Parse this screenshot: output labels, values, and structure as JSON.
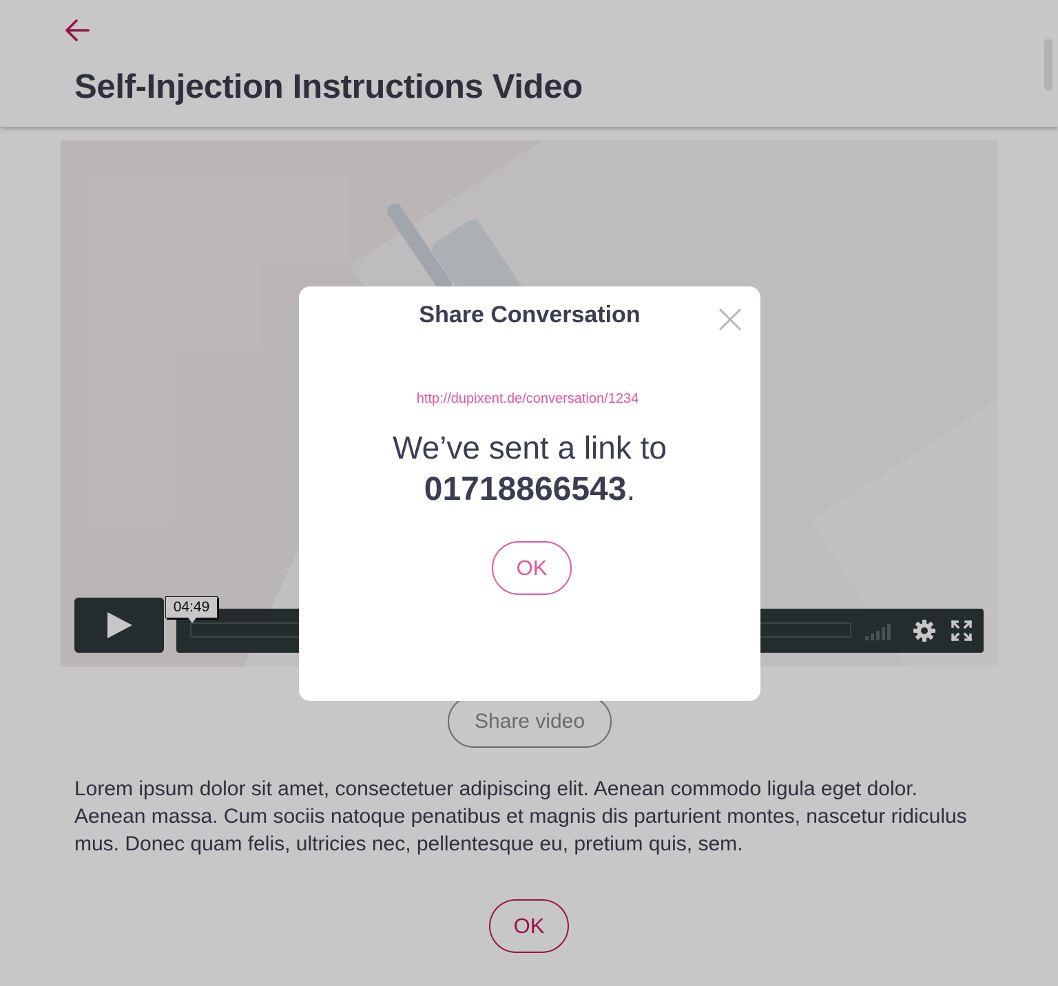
{
  "header": {
    "title": "Self-Injection Instructions Video"
  },
  "video": {
    "time": "04:49"
  },
  "share_video_label": "Share video",
  "description": "Lorem ipsum dolor sit amet, consectetuer adipiscing elit. Aenean commodo ligula eget dolor. Aenean massa. Cum sociis natoque penatibus et magnis dis parturient montes, nascetur ridiculus mus. Donec quam felis, ultricies nec, pellentesque eu, pretium quis, sem.",
  "page_ok_label": "OK",
  "modal": {
    "title": "Share Conversation",
    "link": "http://dupixent.de/conversation/1234",
    "message_prefix": "We’ve sent a link to",
    "phone": "01718866543",
    "message_suffix": ".",
    "ok_label": "OK"
  },
  "colors": {
    "accent": "#c2185b",
    "link_pink": "#e3559a",
    "text_dark": "#3b3e50",
    "player_dark": "#2e3a3a"
  },
  "icons": {
    "back": "arrow-left-icon",
    "play": "play-icon",
    "volume": "volume-icon",
    "settings": "gear-icon",
    "fullscreen": "fullscreen-icon",
    "close": "close-icon"
  }
}
